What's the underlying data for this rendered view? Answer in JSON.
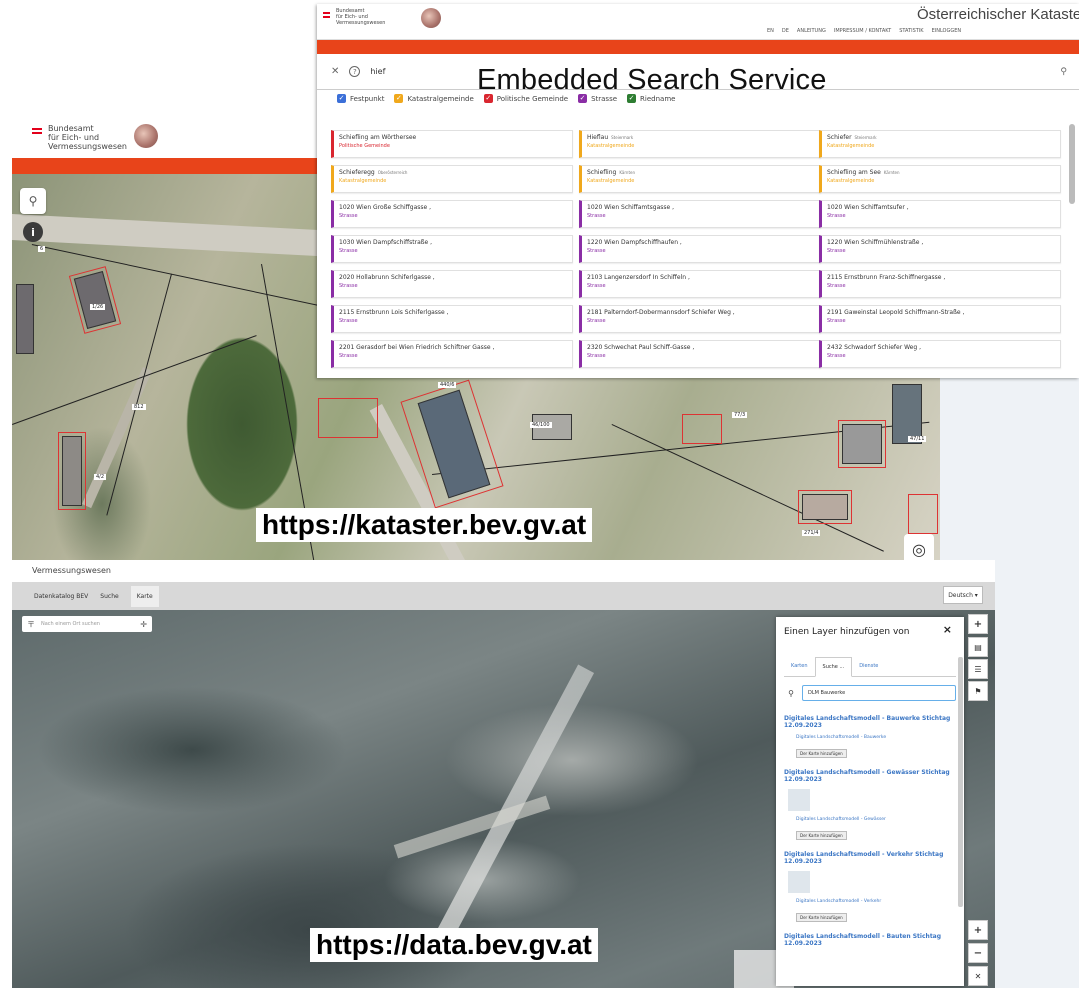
{
  "search_popup": {
    "org_line1": "Bundesamt",
    "org_line2": "für Eich- und",
    "org_line3": "Vermessungswesen",
    "site_title": "Österreichischer Kataster",
    "nav": [
      "EN",
      "DE",
      "ANLEITUNG",
      "IMPRESSUM / KONTAKT",
      "STATISTIK",
      "EINLOGGEN"
    ],
    "close_glyph": "✕",
    "help_glyph": "?",
    "query": "hief",
    "search_glyph": "⚲",
    "overlay_label": "Embedded Search Service",
    "filters": [
      {
        "label": "Festpunkt",
        "color": "#3b6fd8"
      },
      {
        "label": "Katastralgemeinde",
        "color": "#f0a81c"
      },
      {
        "label": "Politische Gemeinde",
        "color": "#d9262f"
      },
      {
        "label": "Strasse",
        "color": "#8a2da5"
      },
      {
        "label": "Riedname",
        "color": "#2e7d32"
      }
    ],
    "results": [
      {
        "title": "Schiefling am Wörthersee",
        "sub": "",
        "cat": "Politische Gemeinde",
        "color": "#d9262f"
      },
      {
        "title": "Hieflau",
        "sub": "Steiermark",
        "cat": "Katastralgemeinde",
        "color": "#f0a81c"
      },
      {
        "title": "Schiefer",
        "sub": "Steiermark",
        "cat": "Katastralgemeinde",
        "color": "#f0a81c"
      },
      {
        "title": "Schieferegg",
        "sub": "Oberösterreich",
        "cat": "Katastralgemeinde",
        "color": "#f0a81c"
      },
      {
        "title": "Schiefling",
        "sub": "Kärnten",
        "cat": "Katastralgemeinde",
        "color": "#f0a81c"
      },
      {
        "title": "Schiefling am See",
        "sub": "Kärnten",
        "cat": "Katastralgemeinde",
        "color": "#f0a81c"
      },
      {
        "title": "1020 Wien Große Schiffgasse ,",
        "sub": "",
        "cat": "Strasse",
        "color": "#8a2da5"
      },
      {
        "title": "1020 Wien Schiffamtsgasse ,",
        "sub": "",
        "cat": "Strasse",
        "color": "#8a2da5"
      },
      {
        "title": "1020 Wien Schiffamtsufer ,",
        "sub": "",
        "cat": "Strasse",
        "color": "#8a2da5"
      },
      {
        "title": "1030 Wien Dampfschiffstraße ,",
        "sub": "",
        "cat": "Strasse",
        "color": "#8a2da5"
      },
      {
        "title": "1220 Wien Dampfschiffhaufen ,",
        "sub": "",
        "cat": "Strasse",
        "color": "#8a2da5"
      },
      {
        "title": "1220 Wien Schiffmühlenstraße ,",
        "sub": "",
        "cat": "Strasse",
        "color": "#8a2da5"
      },
      {
        "title": "2020 Hollabrunn Schiferlgasse ,",
        "sub": "",
        "cat": "Strasse",
        "color": "#8a2da5"
      },
      {
        "title": "2103 Langenzersdorf In Schiffeln ,",
        "sub": "",
        "cat": "Strasse",
        "color": "#8a2da5"
      },
      {
        "title": "2115 Ernstbrunn Franz-Schiffnergasse ,",
        "sub": "",
        "cat": "Strasse",
        "color": "#8a2da5"
      },
      {
        "title": "2115 Ernstbrunn Lois Schiferlgasse ,",
        "sub": "",
        "cat": "Strasse",
        "color": "#8a2da5"
      },
      {
        "title": "2181 Palterndorf-Dobermannsdorf Schiefer Weg ,",
        "sub": "",
        "cat": "Strasse",
        "color": "#8a2da5"
      },
      {
        "title": "2191 Gaweinstal Leopold Schiffmann-Straße ,",
        "sub": "",
        "cat": "Strasse",
        "color": "#8a2da5"
      },
      {
        "title": "2201 Gerasdorf bei Wien Friedrich Schiftner Gasse ,",
        "sub": "",
        "cat": "Strasse",
        "color": "#8a2da5"
      },
      {
        "title": "2320 Schwechat Paul Schiff-Gasse ,",
        "sub": "",
        "cat": "Strasse",
        "color": "#8a2da5"
      },
      {
        "title": "2432 Schwadorf Schiefer Weg ,",
        "sub": "",
        "cat": "Strasse",
        "color": "#8a2da5"
      }
    ]
  },
  "kataster": {
    "org_line1": "Bundesamt",
    "org_line2": "für Eich- und",
    "org_line3": "Vermessungswesen",
    "search_glyph": "⚲",
    "info_glyph": "i",
    "locate_glyph": "◎",
    "url": "https://kataster.bev.gv.at",
    "parcel_labels": [
      "1/26",
      "6",
      "812",
      "4/2",
      "46/100",
      "440/6",
      "77/3",
      "271/4",
      "47/11"
    ]
  },
  "databev": {
    "org_line3": "Vermessungswesen",
    "nav": [
      "Datenkatalog BEV",
      "Suche",
      "Karte"
    ],
    "language": "Deutsch ▾",
    "search_placeholder": "Nach einem Ort suchen",
    "url": "https://data.bev.gv.at",
    "layer_panel": {
      "title": "Einen Layer hinzufügen von",
      "close": "×",
      "tabs": [
        "Karten",
        "Suche ...",
        "Dienste"
      ],
      "query": "DLM Bauwerke",
      "add_label": "Der Karte hinzufügen",
      "results": [
        {
          "heading": "Digitales Landschaftsmodell - Bauwerke Stichtag 12.09.2023",
          "item": "Digitales Landschaftsmodell - Bauwerke"
        },
        {
          "heading": "Digitales Landschaftsmodell - Gewässer Stichtag 12.09.2023",
          "item": "Digitales Landschaftsmodell - Gewässer"
        },
        {
          "heading": "Digitales Landschaftsmodell - Verkehr Stichtag 12.09.2023",
          "item": "Digitales Landschaftsmodell - Verkehr"
        },
        {
          "heading": "Digitales Landschaftsmodell - Bauten Stichtag 12.09.2023",
          "item": ""
        }
      ]
    },
    "controls": [
      "+",
      "▤",
      "☰",
      "⚑",
      "+",
      "−",
      "✕"
    ]
  }
}
